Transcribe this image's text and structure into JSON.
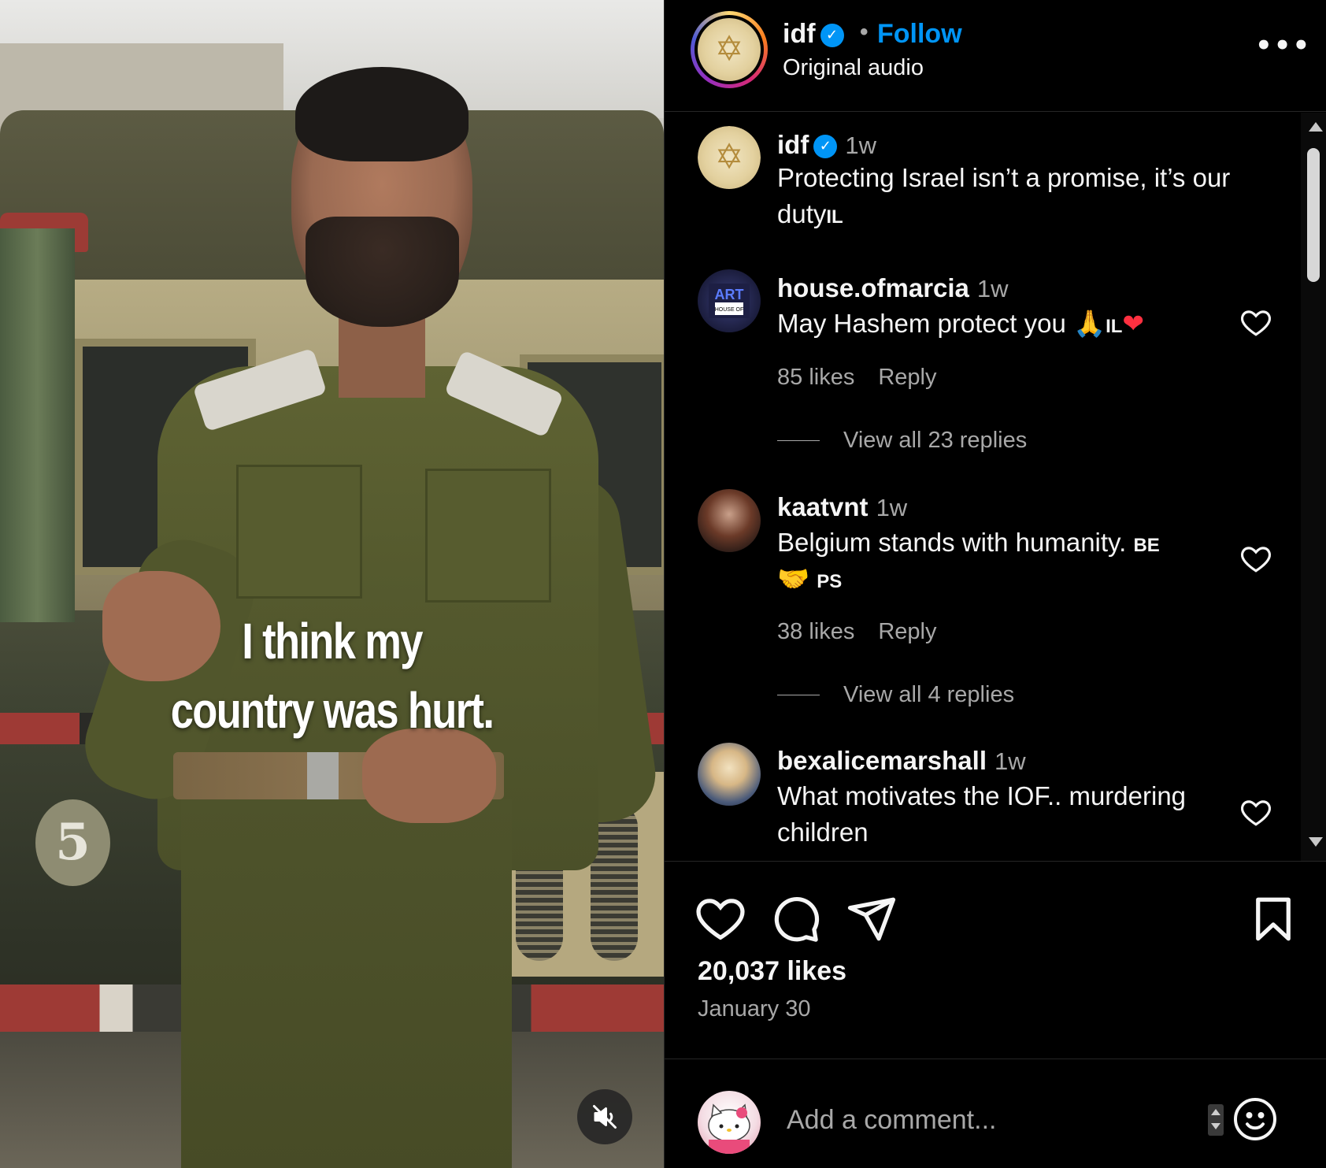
{
  "video": {
    "caption_line1": "I think my",
    "caption_line2": "country was hurt.",
    "truck_number": "5",
    "mute_icon": "speaker-muted-icon"
  },
  "header": {
    "username": "idf",
    "verified": true,
    "separator": "•",
    "follow_label": "Follow",
    "audio_label": "Original audio",
    "more_label": "•••"
  },
  "post": {
    "username": "idf",
    "time": "1w",
    "caption": "Protecting Israel isn’t a promise, it’s our duty",
    "caption_flag": "IL"
  },
  "comments": [
    {
      "username": "house.ofmarcia",
      "time": "1w",
      "text": "May Hashem protect you",
      "emoji1": "🙏",
      "flag": "IL",
      "emoji2": "❤",
      "likes": "85 likes",
      "reply_label": "Reply",
      "view_replies": "View all 23 replies"
    },
    {
      "username": "kaatvnt",
      "time": "1w",
      "text": "Belgium stands with humanity.",
      "flag1": "BE",
      "emoji": "🤝",
      "flag2": "PS",
      "likes": "38 likes",
      "reply_label": "Reply",
      "view_replies": "View all 4 replies"
    },
    {
      "username": "bexalicemarshall",
      "time": "1w",
      "text": "What motivates the IOF.. murdering children"
    }
  ],
  "actions": {
    "likes": "20,037 likes",
    "date": "January 30",
    "comment_placeholder": "Add a comment..."
  },
  "colors": {
    "accent": "#0095f6",
    "background": "#000000",
    "secondary_text": "#a8a8a8",
    "heart_red": "#ff3040"
  }
}
